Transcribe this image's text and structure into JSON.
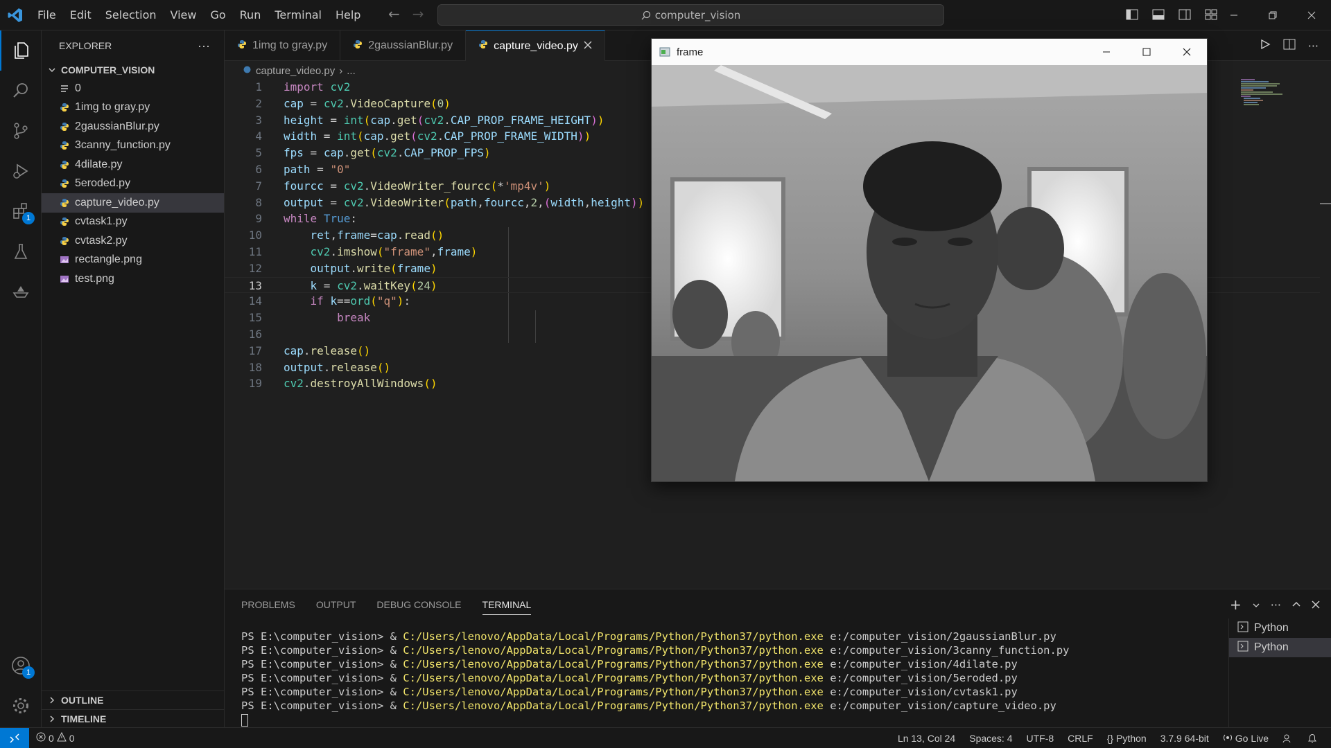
{
  "menu": [
    "File",
    "Edit",
    "Selection",
    "View",
    "Go",
    "Run",
    "Terminal",
    "Help"
  ],
  "command_center": "computer_vision",
  "activity_badges": {
    "extensions": "1",
    "accounts": "1"
  },
  "explorer": {
    "title": "EXPLORER",
    "more": "···",
    "folder": "COMPUTER_VISION",
    "files": [
      {
        "name": "0",
        "type": "text"
      },
      {
        "name": "1img to gray.py",
        "type": "python"
      },
      {
        "name": "2gaussianBlur.py",
        "type": "python"
      },
      {
        "name": "3canny_function.py",
        "type": "python"
      },
      {
        "name": "4dilate.py",
        "type": "python"
      },
      {
        "name": "5eroded.py",
        "type": "python"
      },
      {
        "name": "capture_video.py",
        "type": "python",
        "selected": true
      },
      {
        "name": "cvtask1.py",
        "type": "python"
      },
      {
        "name": "cvtask2.py",
        "type": "python"
      },
      {
        "name": "rectangle.png",
        "type": "image"
      },
      {
        "name": "test.png",
        "type": "image"
      }
    ],
    "outline": "OUTLINE",
    "timeline": "TIMELINE"
  },
  "tabs": [
    {
      "label": "1img to gray.py",
      "active": false
    },
    {
      "label": "2gaussianBlur.py",
      "active": false
    },
    {
      "label": "capture_video.py",
      "active": true
    }
  ],
  "breadcrumb": {
    "file": "capture_video.py",
    "rest": "..."
  },
  "code_lines": [
    "import cv2",
    "cap = cv2.VideoCapture(0)",
    "height = int(cap.get(cv2.CAP_PROP_FRAME_HEIGHT))",
    "width = int(cap.get(cv2.CAP_PROP_FRAME_WIDTH))",
    "fps = cap.get(cv2.CAP_PROP_FPS)",
    "path = \"0\"",
    "fourcc = cv2.VideoWriter_fourcc(*'mp4v')",
    "output = cv2.VideoWriter(path,fourcc,2,(width,height))",
    "while True:",
    "    ret,frame=cap.read()",
    "    cv2.imshow(\"frame\",frame)",
    "    output.write(frame)",
    "    k = cv2.waitKey(24)",
    "    if k==ord(\"q\"):",
    "        break",
    "",
    "cap.release()",
    "output.release()",
    "cv2.destroyAllWindows()"
  ],
  "current_line": 13,
  "frame_window": {
    "title": "frame"
  },
  "panel": {
    "tabs": [
      {
        "label": "PROBLEMS",
        "active": false
      },
      {
        "label": "OUTPUT",
        "active": false
      },
      {
        "label": "DEBUG CONSOLE",
        "active": false
      },
      {
        "label": "TERMINAL",
        "active": true
      }
    ],
    "terminal_lines": [
      {
        "prompt": "PS E:\\computer_vision> & ",
        "exe": "C:/Users/lenovo/AppData/Local/Programs/Python/Python37/python.exe",
        "arg": " e:/computer_vision/2gaussianBlur.py"
      },
      {
        "prompt": "PS E:\\computer_vision> & ",
        "exe": "C:/Users/lenovo/AppData/Local/Programs/Python/Python37/python.exe",
        "arg": " e:/computer_vision/3canny_function.py"
      },
      {
        "prompt": "PS E:\\computer_vision> & ",
        "exe": "C:/Users/lenovo/AppData/Local/Programs/Python/Python37/python.exe",
        "arg": " e:/computer_vision/4dilate.py"
      },
      {
        "prompt": "PS E:\\computer_vision> & ",
        "exe": "C:/Users/lenovo/AppData/Local/Programs/Python/Python37/python.exe",
        "arg": " e:/computer_vision/5eroded.py"
      },
      {
        "prompt": "PS E:\\computer_vision> & ",
        "exe": "C:/Users/lenovo/AppData/Local/Programs/Python/Python37/python.exe",
        "arg": " e:/computer_vision/cvtask1.py"
      },
      {
        "prompt": "PS E:\\computer_vision> & ",
        "exe": "C:/Users/lenovo/AppData/Local/Programs/Python/Python37/python.exe",
        "arg": " e:/computer_vision/capture_video.py"
      }
    ],
    "terminals": [
      "Python",
      "Python"
    ]
  },
  "status": {
    "errors": "0",
    "warnings": "0",
    "position": "Ln 13, Col 24",
    "spaces": "Spaces: 4",
    "encoding": "UTF-8",
    "eol": "CRLF",
    "language": "Python",
    "interpreter": "3.7.9 64-bit",
    "go_live": "Go Live"
  },
  "colors": {
    "accent": "#0078d4",
    "editor_bg": "#1f1f1f",
    "chrome_bg": "#181818",
    "terminal_exe": "#f0e36a"
  }
}
